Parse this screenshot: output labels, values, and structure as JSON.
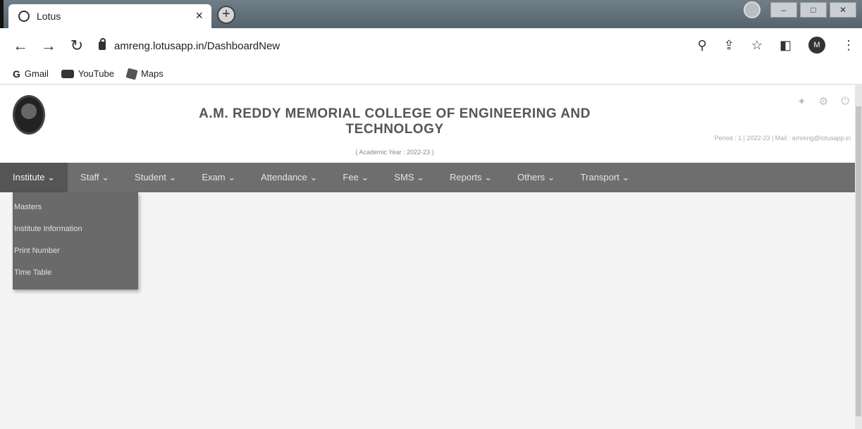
{
  "browser": {
    "tab_title": "Lotus",
    "tab_close": "×",
    "new_tab": "+",
    "url": "amreng.lotusapp.in/DashboardNew",
    "profile_initial": "M",
    "bookmarks": [
      {
        "label": "Gmail",
        "icon": "gmail-icon"
      },
      {
        "label": "YouTube",
        "icon": "youtube-icon"
      },
      {
        "label": "Maps",
        "icon": "maps-icon"
      }
    ]
  },
  "header": {
    "college_name": "A.M. REDDY MEMORIAL COLLEGE OF ENGINEERING AND TECHNOLOGY",
    "academic_year": "( Academic Year : 2022-23 )",
    "user_info": "Period : 1 | 2022-23 | Mail : amreng@lotusapp.in",
    "icons": [
      "notifications-icon",
      "settings-icon",
      "logout-icon"
    ]
  },
  "nav": {
    "items": [
      "Institute ⌄",
      "Staff ⌄",
      "Student ⌄",
      "Exam ⌄",
      "Attendance ⌄",
      "Fee ⌄",
      "SMS ⌄",
      "Reports ⌄",
      "Others ⌄",
      "Transport ⌄"
    ],
    "active_index": 0
  },
  "dropdown": {
    "items": [
      "Masters",
      "Institute Information",
      "Print Number",
      "Time Table"
    ]
  }
}
